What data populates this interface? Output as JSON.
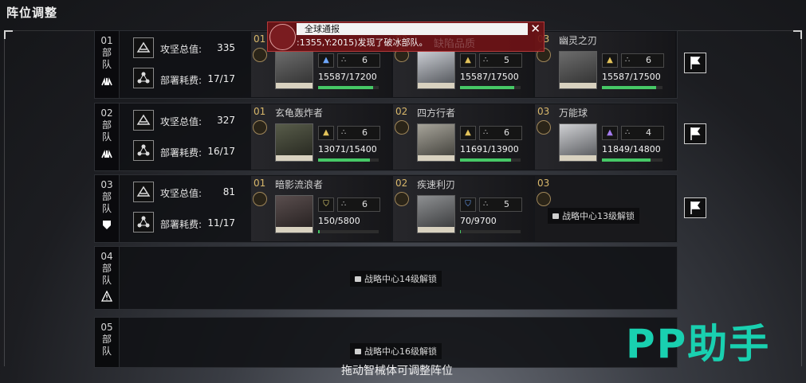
{
  "screen": {
    "title": "阵位调整",
    "hint": "拖动智械体可调整阵位",
    "watermark": "PP助手"
  },
  "toast": {
    "header": "全球通报",
    "message": ":1355,Y:2015)发现了破冰部队。",
    "ghost_text": "缺陷品质"
  },
  "squads": [
    {
      "num": "01",
      "c1": "部",
      "c2": "队",
      "attack_label": "攻坚总值:",
      "attack_value": "335",
      "deploy_label": "部署耗费:",
      "deploy_value": "17/17",
      "units": [
        {
          "pos": "01",
          "name": "",
          "cost": "6",
          "hp": "15587/17200",
          "hp_ratio": 0.906,
          "type": "air"
        },
        {
          "pos": "02",
          "name": "",
          "cost": "5",
          "hp": "15587/17500",
          "hp_ratio": 0.891,
          "type": "ground"
        },
        {
          "pos": "03",
          "name": "幽灵之刃",
          "cost": "6",
          "hp": "15587/17500",
          "hp_ratio": 0.891,
          "type": "ground"
        }
      ]
    },
    {
      "num": "02",
      "c1": "部",
      "c2": "队",
      "attack_label": "攻坚总值:",
      "attack_value": "327",
      "deploy_label": "部署耗费:",
      "deploy_value": "16/17",
      "units": [
        {
          "pos": "01",
          "name": "玄龟轰炸者",
          "cost": "6",
          "hp": "13071/15400",
          "hp_ratio": 0.849,
          "type": "ground"
        },
        {
          "pos": "02",
          "name": "四方行者",
          "cost": "6",
          "hp": "11691/13900",
          "hp_ratio": 0.841,
          "type": "ground"
        },
        {
          "pos": "03",
          "name": "万能球",
          "cost": "4",
          "hp": "11849/14800",
          "hp_ratio": 0.801,
          "type": "purple"
        }
      ]
    },
    {
      "num": "03",
      "c1": "部",
      "c2": "队",
      "attack_label": "攻坚总值:",
      "attack_value": "81",
      "deploy_label": "部署耗费:",
      "deploy_value": "11/17",
      "units": [
        {
          "pos": "01",
          "name": "暗影流浪者",
          "cost": "6",
          "hp": "150/5800",
          "hp_ratio": 0.026,
          "type": "shield"
        },
        {
          "pos": "02",
          "name": "疾速利刃",
          "cost": "5",
          "hp": "70/9700",
          "hp_ratio": 0.007,
          "type": "shield-blue"
        }
      ],
      "slot3_pos": "03",
      "slot3_lock": "战略中心13级解锁"
    },
    {
      "num": "04",
      "c1": "部",
      "c2": "队",
      "lock": "战略中心14级解锁"
    },
    {
      "num": "05",
      "c1": "部",
      "c2": "队",
      "lock": "战略中心16级解锁"
    }
  ],
  "colors": {
    "accent_gold": "#d8b76a",
    "hp_green": "#46c866",
    "toast_red": "#6e1216",
    "watermark": "#19d0b0"
  }
}
